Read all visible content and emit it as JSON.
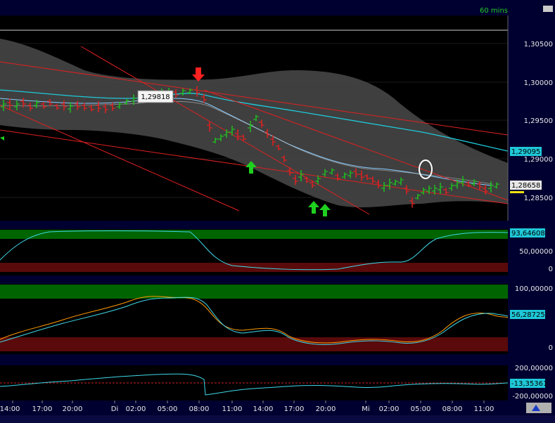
{
  "timeframe": "60 mins",
  "price_axis_labels": [
    "1,30500",
    "1,30000",
    "1,29500",
    "1,29000",
    "1,28500"
  ],
  "last_price": "1,28658",
  "ma_value": "1,29095",
  "callout_price": "1,29818",
  "ind1_value": "93,64608",
  "ind1_axis": [
    "50,00000",
    "0"
  ],
  "ind2_value": "56,28725",
  "ind2_axis": [
    "100,00000",
    "0"
  ],
  "ind3_value": "-13,35361",
  "ind3_axis": [
    "200,00000",
    "-200,00000"
  ],
  "time_labels": [
    "14:00",
    "17:00",
    "20:00",
    "Di",
    "02:00",
    "05:00",
    "08:00",
    "11:00",
    "14:00",
    "17:00",
    "20:00",
    "Mi",
    "02:00",
    "05:00",
    "08:00",
    "11:00"
  ],
  "colors": {
    "background": "#000000",
    "panel_bg": "#000018",
    "up": "#1fbf1f",
    "down": "#e02020",
    "band": "#4a4a4a",
    "ma_fast": "#88ccff",
    "ma_slow": "#1fc8d8",
    "overbought_zone": "#006400",
    "oversold_zone": "#5a0a0a"
  },
  "icons": [
    "arrow-down-red-icon",
    "arrow-up-green-icon",
    "circle-annotation-icon",
    "scroll-icon"
  ]
}
